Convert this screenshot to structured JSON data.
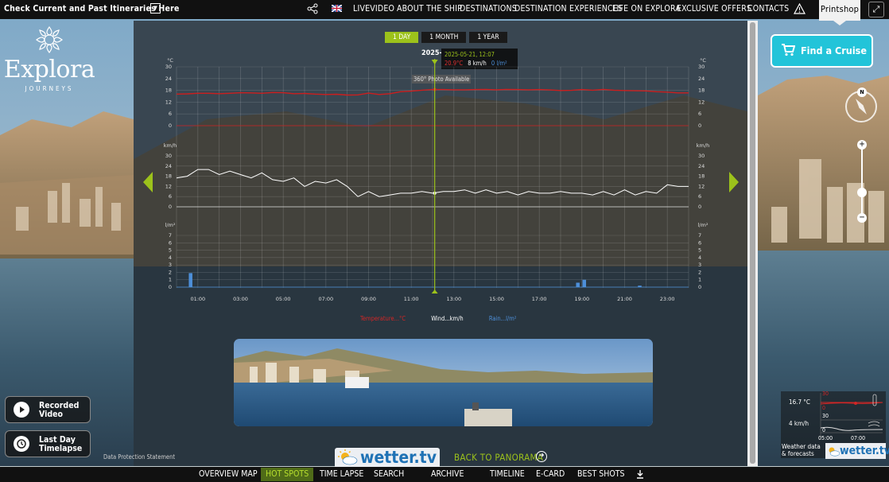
{
  "header": {
    "itineraries_label": "Check Current and Past Itineraries Here",
    "nav_items": [
      "LIVEVIDEO",
      "ABOUT THE SHIP",
      "DESTINATIONS",
      "DESTINATION EXPERIENCES",
      "LIFE ON EXPLORA",
      "EXCLUSIVE OFFERS",
      "CONTACTS"
    ],
    "printshop": "Printshop"
  },
  "brand": {
    "name": "Explora",
    "subtitle": "JOURNEYS"
  },
  "find_cruise": "Find a Cruise",
  "side_buttons": {
    "recorded": [
      "Recorded",
      "Video"
    ],
    "timelapse": [
      "Last Day",
      "Timelapse"
    ]
  },
  "range_tabs": [
    "1 DAY",
    "1 MONTH",
    "1 YEAR"
  ],
  "active_tab": 0,
  "tooltip": {
    "date_stub": "2025-",
    "timestamp": "2025-05-21, 12:07",
    "temperature": "20.9°C",
    "wind": "8 km/h",
    "rain": "0 l/m²",
    "photo_note": "360° Photo Available"
  },
  "legend": [
    "Temperature...°C",
    "Wind...km/h",
    "Rain...l/m²"
  ],
  "colors": {
    "accent": "#9cc21b",
    "temperature": "#cc1e1e",
    "wind": "#ffffff",
    "rain": "#4d8fd9",
    "cruise": "#22c4d9"
  },
  "chart_data": {
    "type": "line",
    "x_tick_labels": [
      "01:00",
      "03:00",
      "05:00",
      "07:00",
      "09:00",
      "11:00",
      "13:00",
      "15:00",
      "17:00",
      "19:00",
      "21:00",
      "23:00"
    ],
    "panels": [
      {
        "name": "temperature",
        "unit_label": "°C",
        "yticks": [
          "30",
          "24",
          "18",
          "12",
          "6",
          "0"
        ],
        "ylim": [
          0,
          30
        ],
        "x": [
          0,
          0.5,
          1,
          1.5,
          2,
          2.5,
          3,
          3.5,
          4,
          4.5,
          5,
          5.5,
          6,
          6.5,
          7,
          7.5,
          8,
          8.5,
          9,
          9.5,
          10,
          10.5,
          11,
          11.5,
          12,
          12.5,
          13,
          13.5,
          14,
          14.5,
          15,
          15.5,
          16,
          16.5,
          17,
          17.5,
          18,
          18.5,
          19,
          19.5,
          20,
          20.5,
          21,
          21.5,
          22,
          22.5,
          23,
          23.5,
          24
        ],
        "values": [
          16.1,
          16.2,
          16.5,
          16.5,
          16.3,
          16.5,
          16.8,
          16.7,
          16.5,
          16.9,
          16.8,
          16.3,
          16.4,
          16.1,
          15.9,
          16,
          15.6,
          15.7,
          16.6,
          15.9,
          16.3,
          17.3,
          17.6,
          18.1,
          18.4,
          18.4,
          18.3,
          18.3,
          18.4,
          18.5,
          18.3,
          18.5,
          18.4,
          18.3,
          18.4,
          18.2,
          17.9,
          18,
          18.4,
          18.1,
          18.5,
          18.1,
          17.9,
          17.8,
          17.7,
          17.3,
          17.1,
          16.7,
          16.7
        ]
      },
      {
        "name": "wind",
        "unit_label": "km/h",
        "yticks": [
          "30",
          "24",
          "18",
          "12",
          "6",
          "0"
        ],
        "ylim": [
          0,
          30
        ],
        "x": [
          0,
          0.5,
          1,
          1.5,
          2,
          2.5,
          3,
          3.5,
          4,
          4.5,
          5,
          5.5,
          6,
          6.5,
          7,
          7.5,
          8,
          8.5,
          9,
          9.5,
          10,
          10.5,
          11,
          11.5,
          12,
          12.5,
          13,
          13.5,
          14,
          14.5,
          15,
          15.5,
          16,
          16.5,
          17,
          17.5,
          18,
          18.5,
          19,
          19.5,
          20,
          20.5,
          21,
          21.5,
          22,
          22.5,
          23,
          23.5,
          24
        ],
        "values": [
          17,
          18,
          22,
          22,
          19,
          21,
          19,
          17,
          20,
          16,
          15,
          17,
          12,
          15,
          14,
          16,
          12,
          6,
          9,
          6,
          7,
          8,
          8,
          9,
          8,
          9,
          9,
          10,
          8,
          10,
          8,
          9,
          7,
          9,
          8,
          8,
          9,
          8,
          8,
          7,
          9,
          7,
          10,
          7,
          9,
          8,
          13,
          12,
          12
        ]
      },
      {
        "name": "rain",
        "unit_label": "l/m²",
        "yticks": [
          "7",
          "6",
          "5",
          "4",
          "3",
          "2",
          "1",
          "0"
        ],
        "ylim": [
          0,
          7
        ],
        "bars": [
          {
            "x": 0.65,
            "value": 1.9
          },
          {
            "x": 18.8,
            "value": 0.6
          },
          {
            "x": 19.1,
            "value": 1.0
          },
          {
            "x": 21.7,
            "value": 0.2
          }
        ]
      }
    ],
    "cursor_x": 12.1
  },
  "footer": {
    "wetter": "wetter.tv",
    "back_to_panorama": "BACK TO PANORAMA",
    "data_protection": "Data Protection Statement",
    "bottom_nav": [
      "OVERVIEW MAP",
      "HOT SPOTS",
      "TIME LAPSE",
      "SEARCH",
      "ARCHIVE",
      "TIMELINE",
      "E-CARD",
      "BEST SHOTS"
    ],
    "active_bottom": 1
  },
  "mini_widget": {
    "temperature": "16.7 °C",
    "wind": "4 km/h",
    "temp_ticks": [
      "30",
      "0"
    ],
    "wind_ticks": [
      "30",
      "0"
    ],
    "x_ticks": [
      "05:00",
      "07:00"
    ],
    "label": "Weather data & forecasts",
    "wetter": "wetter.tv"
  }
}
